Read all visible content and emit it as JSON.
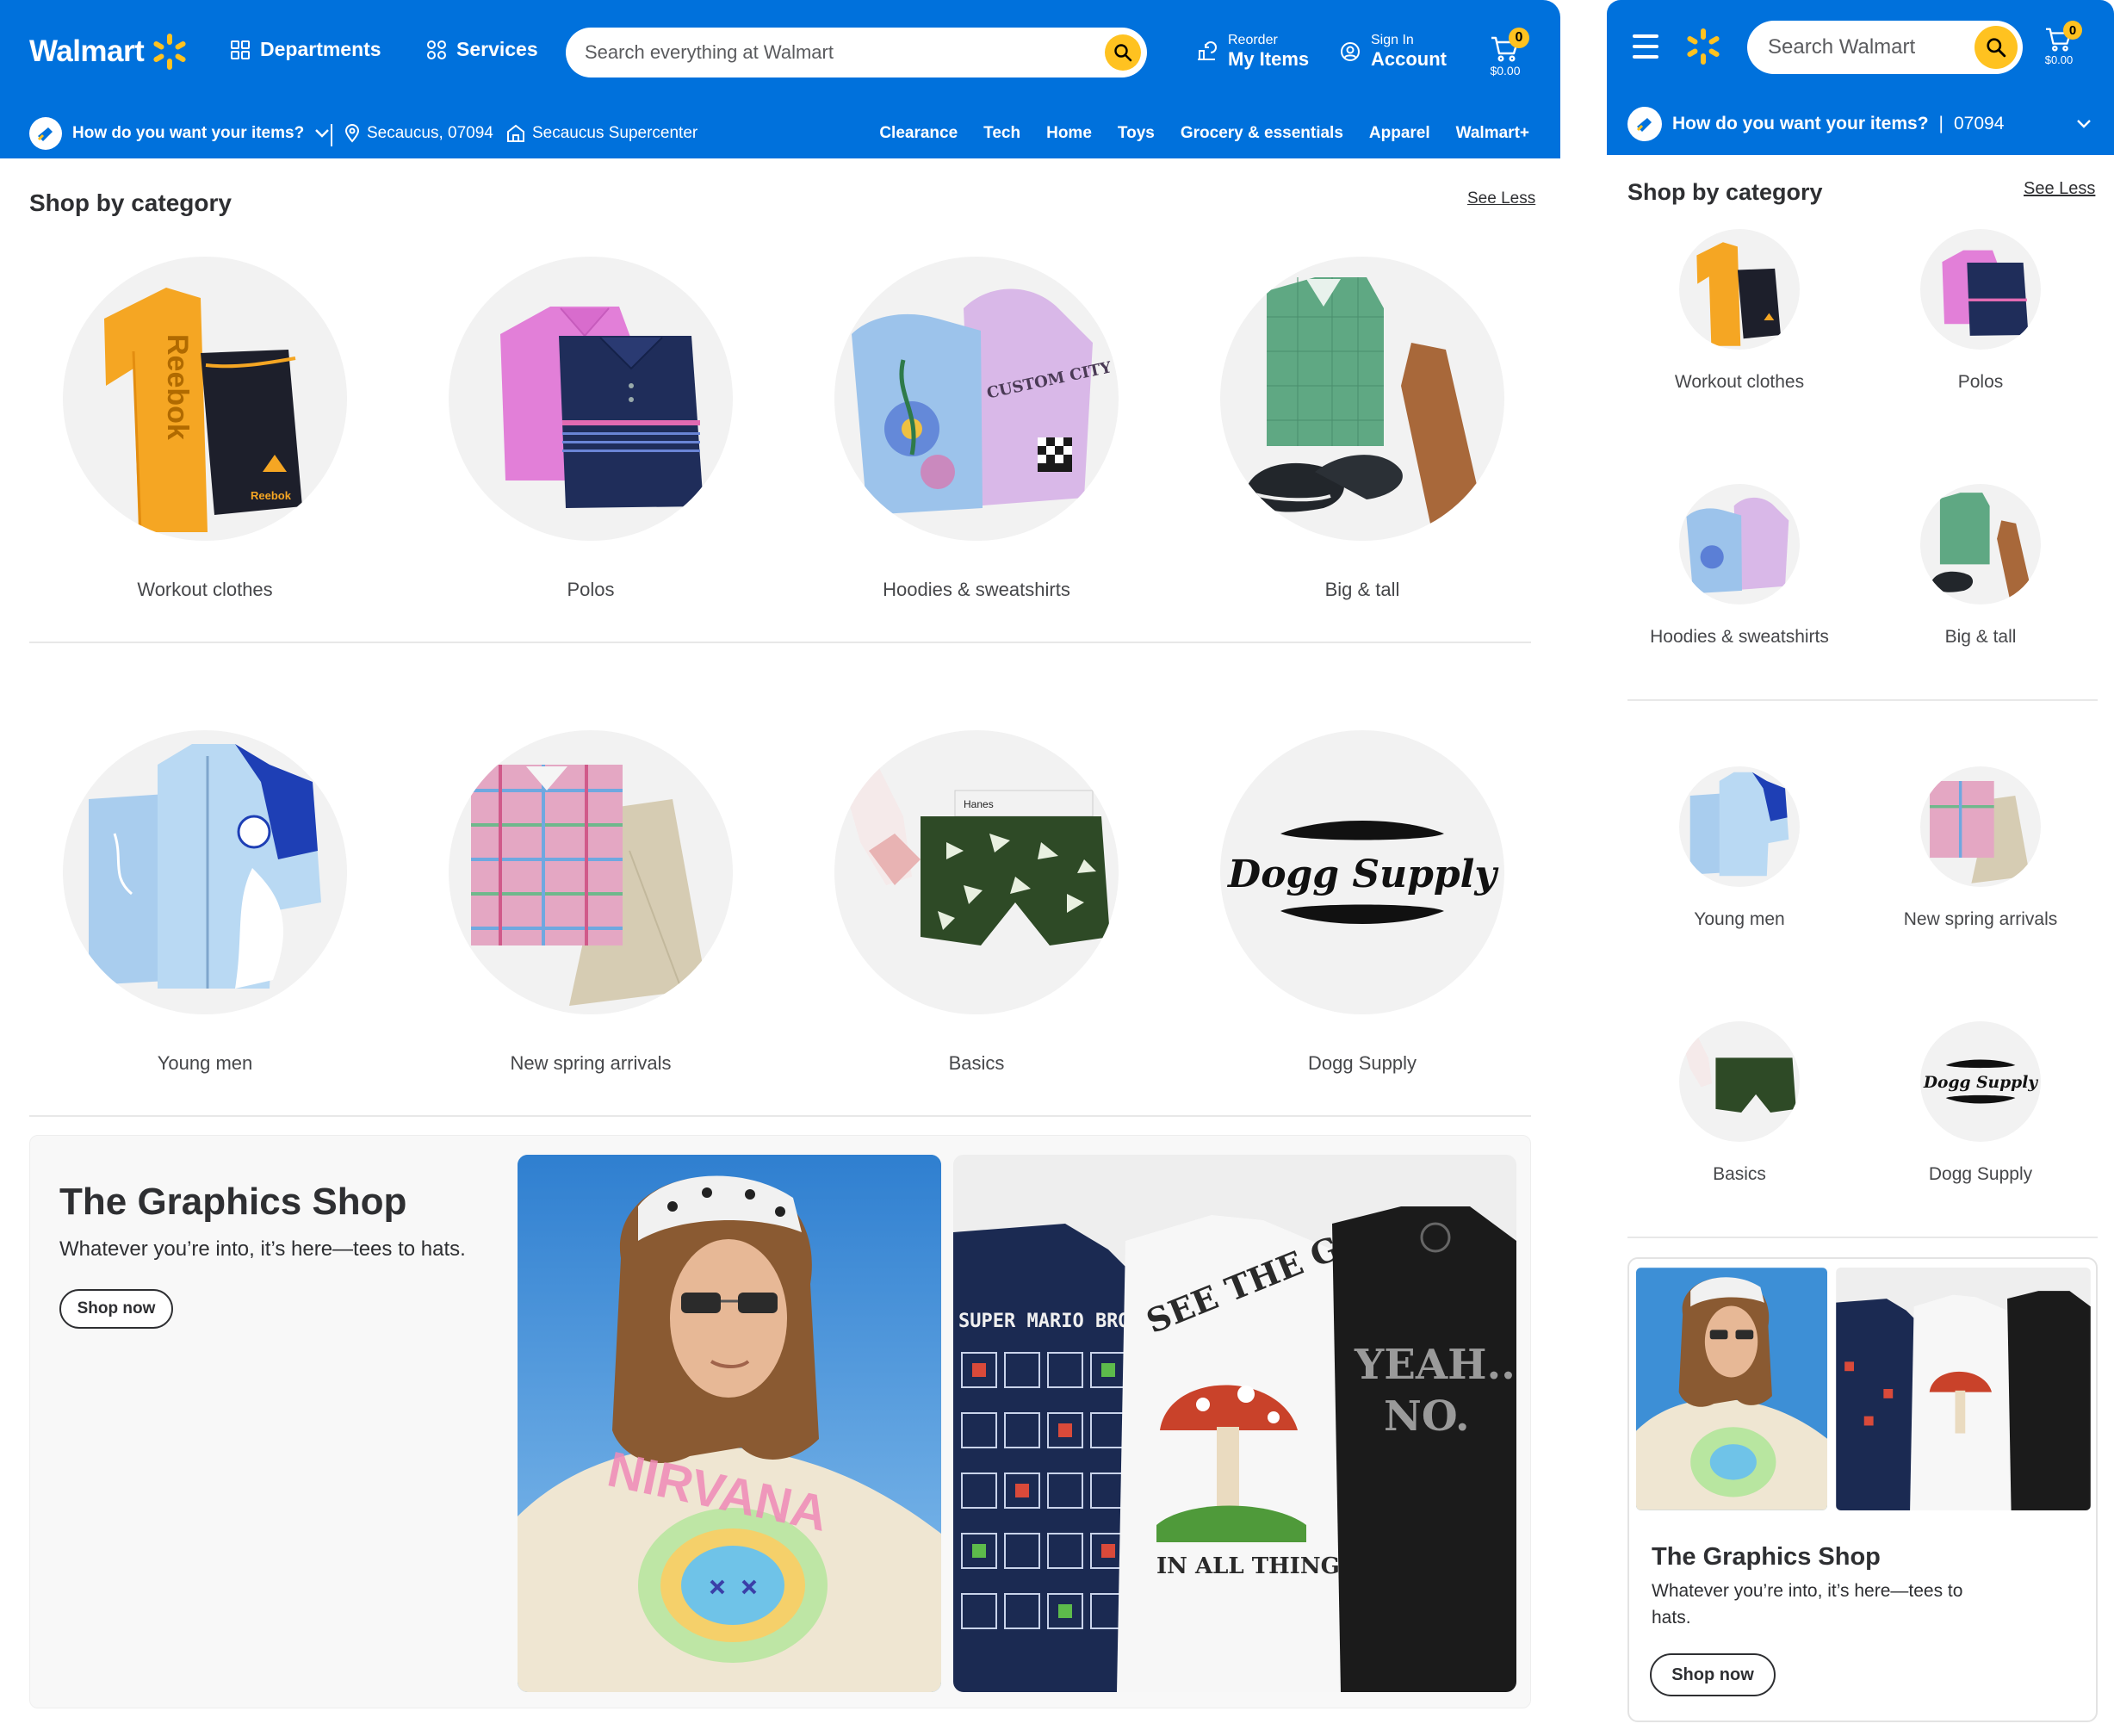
{
  "brand": {
    "name": "Walmart",
    "blue": "#0071dc",
    "yellow": "#ffc220"
  },
  "desktop": {
    "header": {
      "departments_label": "Departments",
      "services_label": "Services",
      "search_placeholder": "Search everything at Walmart",
      "reorder_small": "Reorder",
      "reorder_big": "My Items",
      "signin_small": "Sign In",
      "signin_big": "Account",
      "cart_count": "0",
      "cart_total": "$0.00"
    },
    "subbar": {
      "fulfillment_question": "How do you want your items?",
      "location": "Secaucus, 07094",
      "store": "Secaucus Supercenter",
      "links": [
        "Clearance",
        "Tech",
        "Home",
        "Toys",
        "Grocery & essentials",
        "Apparel",
        "Walmart+"
      ]
    },
    "shop_by_category": {
      "title": "Shop by category",
      "see_less": "See Less",
      "categories": [
        "Workout clothes",
        "Polos",
        "Hoodies & sweatshirts",
        "Big & tall",
        "Young men",
        "New spring arrivals",
        "Basics",
        "Dogg Supply"
      ]
    },
    "graphics_shop": {
      "title": "The Graphics Shop",
      "subtitle": "Whatever you’re into, it’s here—tees to hats.",
      "cta": "Shop now"
    }
  },
  "mobile": {
    "header": {
      "search_placeholder": "Search Walmart",
      "cart_count": "0",
      "cart_total": "$0.00"
    },
    "subbar": {
      "fulfillment_question": "How do you want your items?",
      "zip": "07094"
    },
    "shop_by_category": {
      "title": "Shop by category",
      "see_less": "See Less",
      "categories": [
        "Workout clothes",
        "Polos",
        "Hoodies & sweatshirts",
        "Big & tall",
        "Young men",
        "New spring arrivals",
        "Basics",
        "Dogg Supply"
      ]
    },
    "graphics_shop": {
      "title": "The Graphics Shop",
      "subtitle": "Whatever you’re into, it’s here—tees to hats.",
      "cta": "Shop now"
    }
  },
  "image_text": {
    "reebok": "Reebok",
    "custom_city": "CUSTOM CITY",
    "dogg_supply_logo": "Dogg Supply",
    "hanes": "Hanes",
    "mario_tee": "SUPER MARIO BROS",
    "mushroom_tee": "SEE THE GOOD",
    "mushroom_tee_sub": "IN ALL THINGS",
    "yeah_tee_line1": "YEAH...",
    "yeah_tee_line2": "NO.",
    "nirvana": "NIRVANA"
  }
}
